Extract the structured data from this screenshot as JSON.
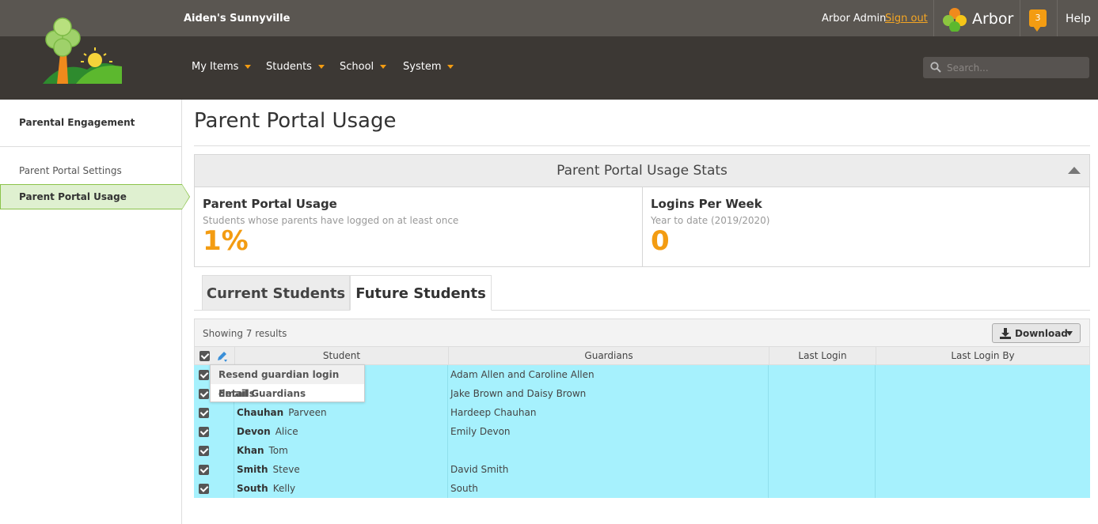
{
  "header": {
    "school_name": "Aiden's Sunnyville",
    "user_name": "Arbor Admin",
    "sign_out": "Sign out",
    "brand": "Arbor",
    "notification_count": "3",
    "help": "Help",
    "nav": [
      {
        "label": "My Items"
      },
      {
        "label": "Students"
      },
      {
        "label": "School"
      },
      {
        "label": "System"
      }
    ],
    "search_placeholder": "Search...",
    "colors": {
      "accent": "#f39c12",
      "topbar": "#5a5651",
      "navbar": "#3c3834"
    }
  },
  "sidebar": {
    "title": "Parental Engagement",
    "items": [
      {
        "label": "Parent Portal Settings",
        "active": false
      },
      {
        "label": "Parent Portal Usage",
        "active": true
      }
    ]
  },
  "main": {
    "title": "Parent Portal Usage",
    "stats": {
      "header": "Parent Portal Usage Stats",
      "boxes": [
        {
          "title": "Parent Portal Usage",
          "subtitle": "Students whose parents have logged on at least once",
          "value": "1%"
        },
        {
          "title": "Logins Per Week",
          "subtitle": "Year to date (2019/2020)",
          "value": "0"
        }
      ]
    },
    "tabs": [
      {
        "label": "Current Students",
        "active": false
      },
      {
        "label": "Future Students",
        "active": true
      }
    ],
    "results_text": "Showing 7 results",
    "download_label": "Download",
    "columns": [
      "Student",
      "Guardians",
      "Last Login",
      "Last Login By"
    ],
    "rows": [
      {
        "surname": "",
        "first": "",
        "guardians": "Adam Allen and Caroline Allen",
        "last_login": "",
        "last_login_by": ""
      },
      {
        "surname": "",
        "first": "",
        "guardians": "Jake Brown and Daisy Brown",
        "last_login": "",
        "last_login_by": ""
      },
      {
        "surname": "Chauhan",
        "first": "Parveen",
        "guardians": "Hardeep Chauhan",
        "last_login": "",
        "last_login_by": ""
      },
      {
        "surname": "Devon",
        "first": "Alice",
        "guardians": "Emily Devon",
        "last_login": "",
        "last_login_by": ""
      },
      {
        "surname": "Khan",
        "first": "Tom",
        "guardians": "",
        "last_login": "",
        "last_login_by": ""
      },
      {
        "surname": "Smith",
        "first": "Steve",
        "guardians": "David Smith",
        "last_login": "",
        "last_login_by": ""
      },
      {
        "surname": "South",
        "first": "Kelly",
        "guardians": "South",
        "last_login": "",
        "last_login_by": ""
      }
    ],
    "bulk_menu": [
      "Resend guardian login details",
      "Email Guardians"
    ],
    "row_highlight_color": "#a6f1fd"
  }
}
